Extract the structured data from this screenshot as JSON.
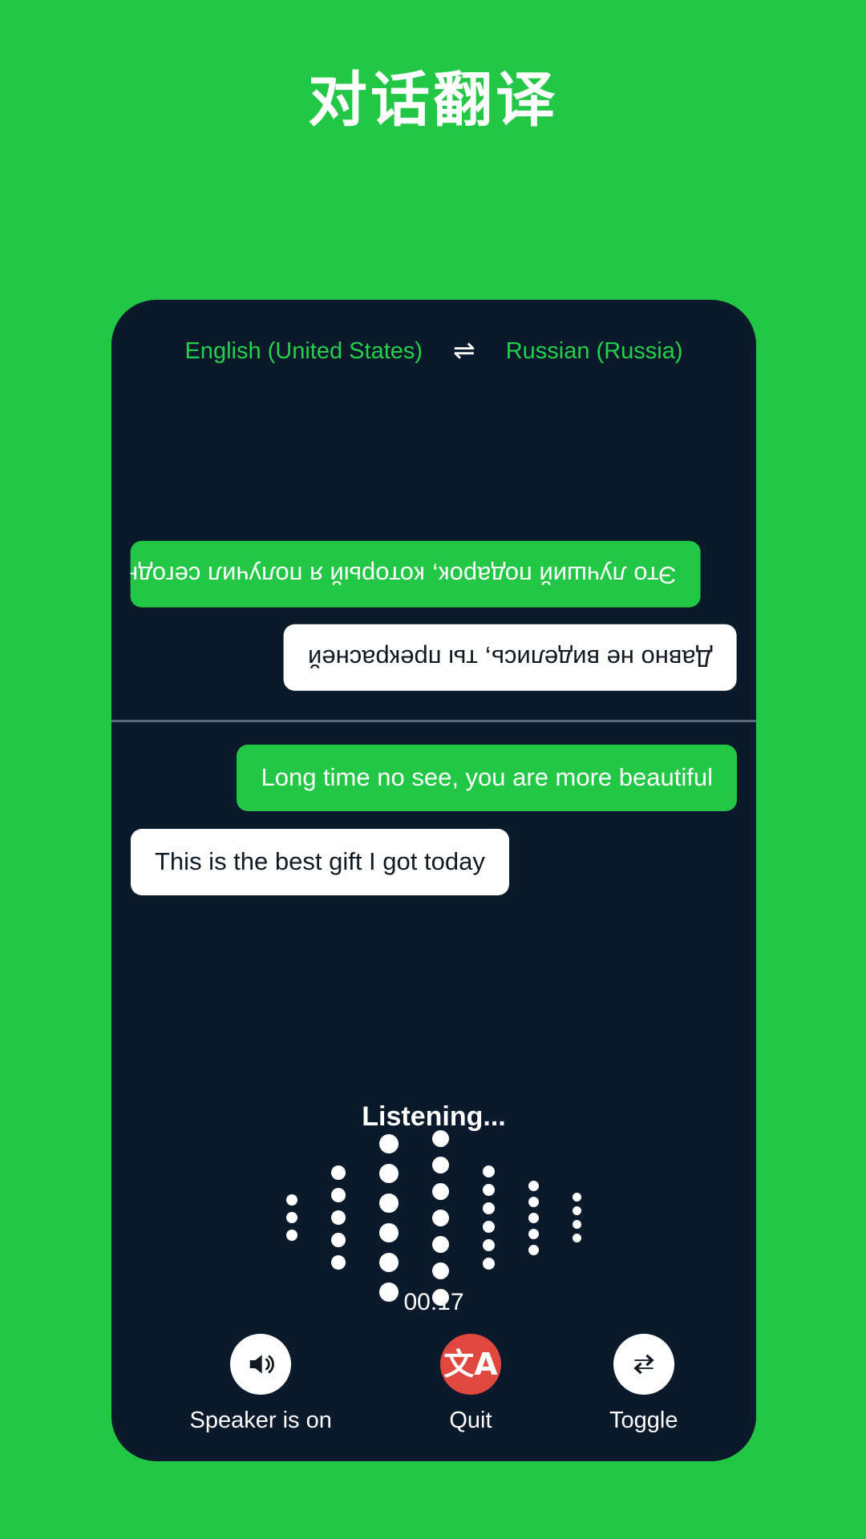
{
  "header": {
    "title": "对话翻译"
  },
  "colors": {
    "background_green": "#22c745",
    "card_dark": "#0a1a2b",
    "accent_green": "#24d04b",
    "quit_red": "#e0483f",
    "bubble_white": "#ffffff",
    "divider_gray": "#5a6a78"
  },
  "language_bar": {
    "source": "English (United States)",
    "swap_icon": "swap-arrows-icon",
    "swap_glyph": "⇌",
    "target": "Russian (Russia)"
  },
  "conversation": {
    "top_pane_rotated": true,
    "top_messages": [
      {
        "text": "Это лучший подарок, который я получил сегодня",
        "style": "green",
        "align": "left",
        "language": "ru"
      },
      {
        "text": "Давно не виделись, ты прекрасней",
        "style": "white",
        "align": "right",
        "language": "ru"
      }
    ],
    "bottom_messages": [
      {
        "text": "Long time no see, you are more beautiful",
        "style": "green",
        "align": "right",
        "language": "en"
      },
      {
        "text": "This is the best gift I got today",
        "style": "white",
        "align": "left",
        "language": "en"
      }
    ]
  },
  "status": {
    "listening_label": "Listening...",
    "timer": "00:17"
  },
  "visualizer": {
    "type": "dot-waveform",
    "columns": [
      {
        "count": 3,
        "dot_size": 14
      },
      {
        "count": 5,
        "dot_size": 18
      },
      {
        "count": 6,
        "dot_size": 24
      },
      {
        "count": 7,
        "dot_size": 21
      },
      {
        "count": 6,
        "dot_size": 15
      },
      {
        "count": 5,
        "dot_size": 13
      },
      {
        "count": 4,
        "dot_size": 11
      }
    ]
  },
  "controls": [
    {
      "label": "Speaker is on",
      "icon": "speaker-on-icon",
      "circle": "light",
      "name": "speaker-button"
    },
    {
      "label": "Quit",
      "icon": "translate-icon",
      "glyph": "文A",
      "circle": "red",
      "name": "quit-button"
    },
    {
      "label": "Toggle",
      "icon": "repeat-swap-icon",
      "circle": "light",
      "name": "toggle-button"
    }
  ]
}
